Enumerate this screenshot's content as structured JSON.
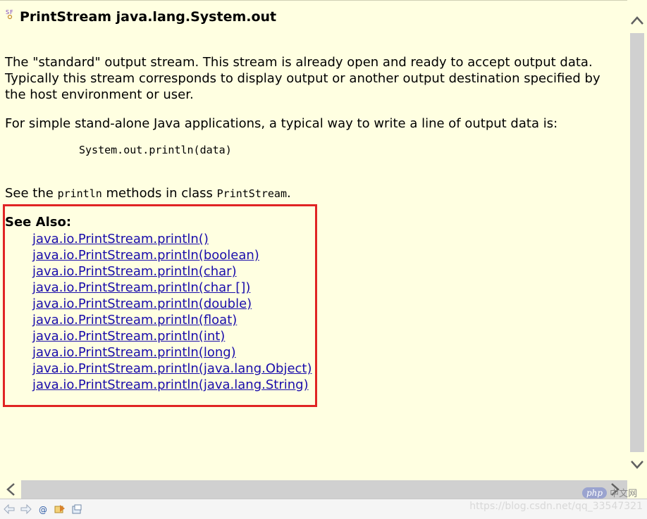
{
  "doc": {
    "title": "PrintStream java.lang.System.out",
    "description": "The \"standard\" output stream. This stream is already open and ready to accept output data. Typically this stream corresponds to display output or another output destination specified by the host environment or user.",
    "usage_intro": "For simple stand-alone Java applications, a typical way to write a line of output data is:",
    "code_example": "System.out.println(data)",
    "see_text_before": "See the ",
    "see_code_method": "println",
    "see_text_middle": " methods in class ",
    "see_code_class": "PrintStream",
    "see_text_end": ".",
    "see_also_heading": "See Also:",
    "see_also_links": [
      "java.io.PrintStream.println()",
      "java.io.PrintStream.println(boolean)",
      "java.io.PrintStream.println(char)",
      "java.io.PrintStream.println(char [])",
      "java.io.PrintStream.println(double)",
      "java.io.PrintStream.println(float)",
      "java.io.PrintStream.println(int)",
      "java.io.PrintStream.println(long)",
      "java.io.PrintStream.println(java.lang.Object)",
      "java.io.PrintStream.println(java.lang.String)"
    ]
  },
  "highlight_color": "#e02424",
  "link_color": "#1a0dab",
  "background_color": "#ffffe1",
  "watermark": "https://blog.csdn.net/qq_33547321",
  "corner_logo": {
    "badge": "php",
    "text": "中文网"
  },
  "toolbar_icons": [
    "back-icon",
    "forward-icon",
    "link-icon",
    "show-source-icon",
    "open-declaration-icon"
  ]
}
